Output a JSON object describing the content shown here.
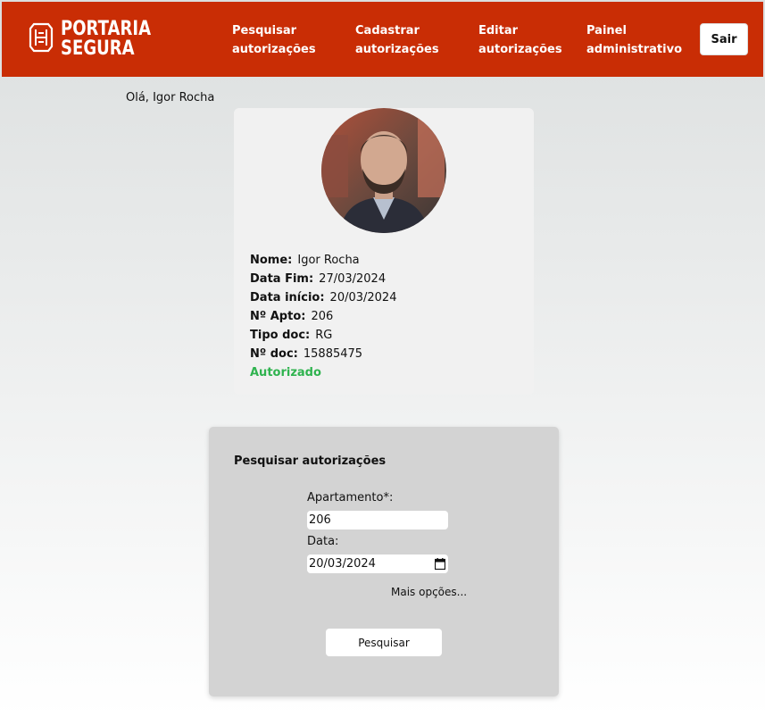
{
  "header": {
    "brand_line1": "PORTARIA",
    "brand_line2": "SEGURA",
    "nav": [
      {
        "line1": "Pesquisar",
        "line2": "autorizações"
      },
      {
        "line1": "Cadastrar",
        "line2": "autorizações"
      },
      {
        "line1": "Editar",
        "line2": "autorizações"
      },
      {
        "line1": "Painel",
        "line2": "administrativo"
      }
    ],
    "logout_label": "Sair",
    "colors": {
      "bar": "#c92d05",
      "text": "#ffffff"
    }
  },
  "greeting": "Olá, Igor Rocha",
  "profile": {
    "photo_icon": "person-photo",
    "fields": [
      {
        "label": "Nome:",
        "value": "Igor Rocha"
      },
      {
        "label": "Data Fim:",
        "value": "27/03/2024"
      },
      {
        "label": "Data início:",
        "value": "20/03/2024"
      },
      {
        "label": "Nº Apto:",
        "value": "206"
      },
      {
        "label": "Tipo doc:",
        "value": "RG"
      },
      {
        "label": "Nº doc:",
        "value": "15885475"
      }
    ],
    "status": "Autorizado",
    "status_color": "#2fb34f"
  },
  "search": {
    "title": "Pesquisar autorizações",
    "apartment_label": "Apartamento*:",
    "apartment_value": "206",
    "date_label": "Data:",
    "date_value": "20/03/2024",
    "more_options": "Mais opções...",
    "submit_label": "Pesquisar"
  }
}
